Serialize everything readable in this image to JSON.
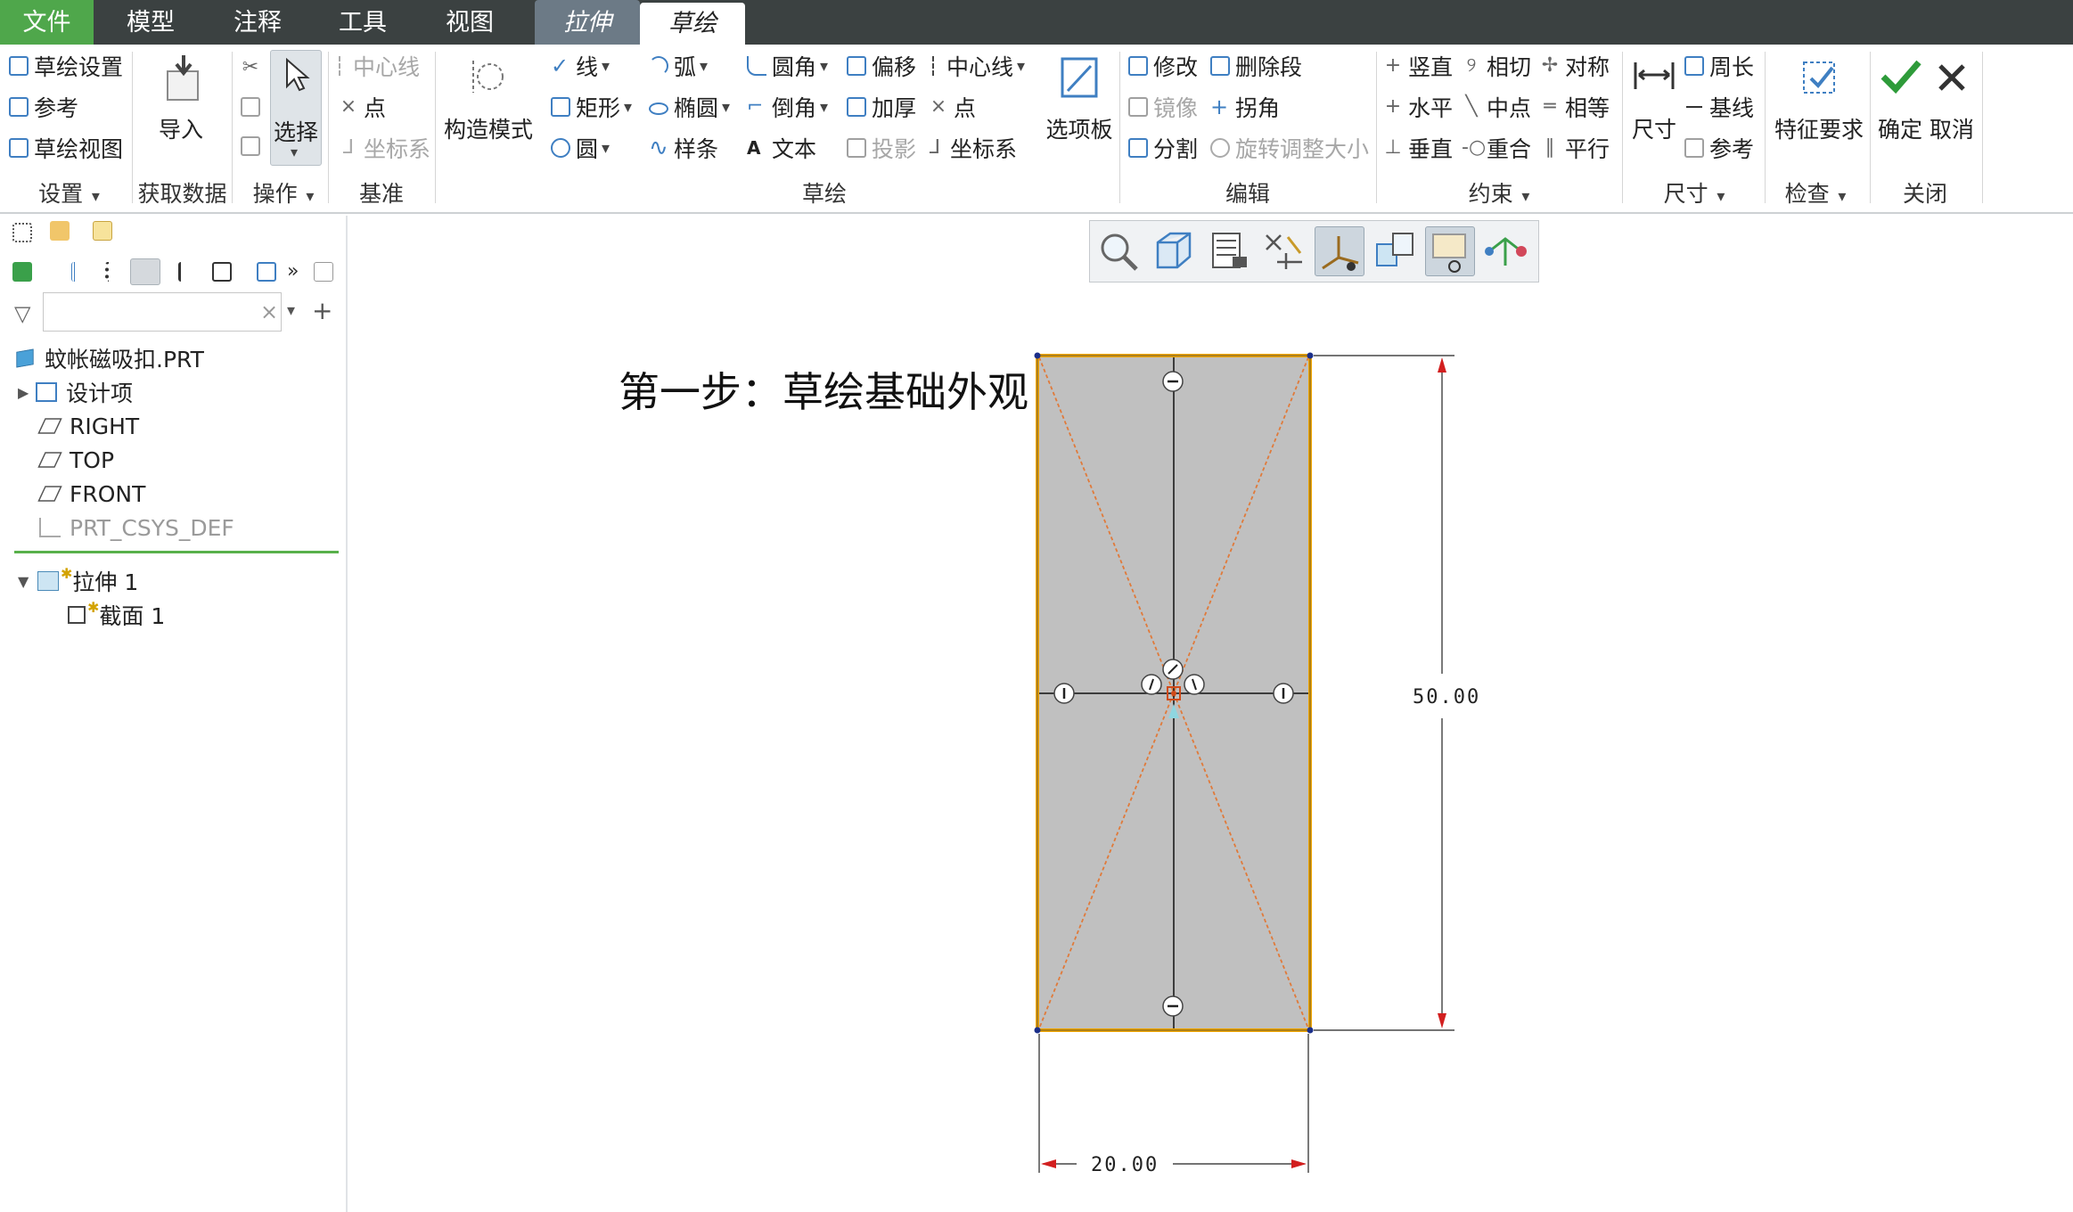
{
  "menu": {
    "file": "文件",
    "model": "模型",
    "annotate": "注释",
    "tools": "工具",
    "view": "视图",
    "extrude": "拉伸",
    "sketch": "草绘"
  },
  "ribbon": {
    "setup": {
      "sketch_setup": "草绘设置",
      "references": "参考",
      "sketch_view": "草绘视图",
      "group": "设置"
    },
    "get_data": {
      "import": "导入",
      "group": "获取数据"
    },
    "operations": {
      "select": "选择",
      "group": "操作"
    },
    "datum": {
      "centerline": "中心线",
      "point": "点",
      "csys": "坐标系",
      "group": "基准"
    },
    "construction_mode": "构造模式",
    "sketching": {
      "line": "线",
      "rectangle": "矩形",
      "circle": "圆",
      "arc": "弧",
      "ellipse": "椭圆",
      "spline": "样条",
      "fillet": "圆角",
      "chamfer": "倒角",
      "text": "文本",
      "offset": "偏移",
      "thicken": "加厚",
      "project": "投影",
      "centerline": "中心线",
      "point": "点",
      "csys": "坐标系",
      "palette": "选项板",
      "group": "草绘"
    },
    "editing": {
      "modify": "修改",
      "delete_segment": "删除段",
      "mirror": "镜像",
      "corner": "拐角",
      "divide": "分割",
      "rotate_resize": "旋转调整大小",
      "group": "编辑"
    },
    "constrain": {
      "vertical": "竖直",
      "tangent": "相切",
      "symmetric": "对称",
      "horizontal": "水平",
      "midpoint": "中点",
      "equal": "相等",
      "perpendicular": "垂直",
      "coincident": "重合",
      "parallel": "平行",
      "group": "约束"
    },
    "dimension": {
      "dimension": "尺寸",
      "perimeter": "周长",
      "baseline": "基线",
      "reference": "参考",
      "group": "尺寸"
    },
    "inspect": {
      "feature_requirements": "特征要求",
      "group": "检查"
    },
    "close": {
      "ok": "确定",
      "cancel": "取消",
      "group": "关闭"
    }
  },
  "tree": {
    "filter_placeholder": "",
    "part": "蚊帐磁吸扣.PRT",
    "design_items": "设计项",
    "right": "RIGHT",
    "top": "TOP",
    "front": "FRONT",
    "csys": "PRT_CSYS_DEF",
    "extrude1": "拉伸 1",
    "section1": "截面 1"
  },
  "canvas": {
    "step_title": "第一步：草绘基础外观",
    "dim_height": "50.00",
    "dim_width": "20.00"
  },
  "colors": {
    "menubar": "#3b4141",
    "file_tab": "#4fa74b",
    "sketch_fill": "#c0c0c0",
    "sketch_edge": "#f0a500",
    "construction": "#e07a3a",
    "dim_arrow": "#d21f1f"
  }
}
